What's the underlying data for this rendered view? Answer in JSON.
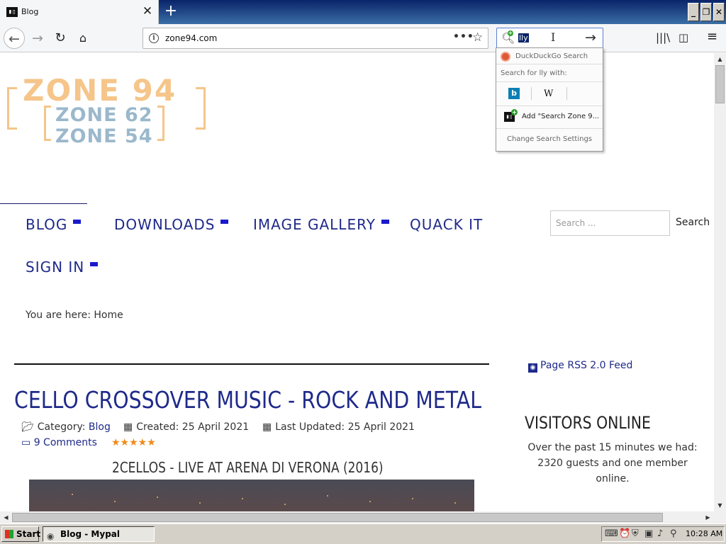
{
  "browser": {
    "tab": {
      "favicon": "▮▯",
      "title": "Blog",
      "close": "✕"
    },
    "new_tab": "+",
    "window_buttons": {
      "minimize": "_",
      "restore": "❐",
      "close": "✕"
    },
    "nav": {
      "back": "←",
      "forward": "→",
      "reload": "↻",
      "home": "⌂"
    },
    "url": "zone94.com",
    "page_actions": "•••",
    "bookmark_star": "☆",
    "search_box": {
      "value": "lly",
      "go": "→"
    },
    "toolbar_right": {
      "library": "|||\\",
      "sidebar": "◫",
      "menu": "≡"
    }
  },
  "search_dropdown": {
    "engine": "DuckDuckGo Search",
    "search_for": "Search for lly with:",
    "alt_engines": [
      "b",
      "W"
    ],
    "add_engine": "Add \"Search Zone 9...",
    "settings": "Change Search Settings"
  },
  "logo": {
    "line1": "ZONE 94",
    "line2": "ZONE 62",
    "line3": "ZONE 54"
  },
  "menu": {
    "blog": "BLOG",
    "downloads": "DOWNLOADS",
    "gallery": "IMAGE GALLERY",
    "quack": "QUACK IT",
    "signin": "SIGN IN"
  },
  "page_search": {
    "placeholder": "Search ...",
    "button": "Search"
  },
  "breadcrumb": "You are here:  Home",
  "article": {
    "title": "CELLO CROSSOVER MUSIC - ROCK AND METAL",
    "category_label": "Category:",
    "category": "Blog",
    "created": "Created: 25 April 2021",
    "updated": "Last Updated: 25 April 2021",
    "comments": "9 Comments",
    "stars": "★★★★★",
    "rating": 5,
    "subtitle": "2CELLOS - LIVE AT ARENA DI VERONA (2016)"
  },
  "sidebar": {
    "rss": "Page RSS 2.0 Feed",
    "visitors_title": "VISITORS ONLINE",
    "visitors_text": "Over the past 15 minutes we had: 2320 guests and one member online."
  },
  "taskbar": {
    "start": "Start",
    "task": "Blog - Mypal",
    "clock": "10:28 AM"
  },
  "colors": {
    "link": "#1f2a8a",
    "logo_orange": "#f5c58a",
    "logo_blue": "#9bb8cc",
    "star": "#f08a18",
    "menu_marker": "#1a1acc"
  }
}
